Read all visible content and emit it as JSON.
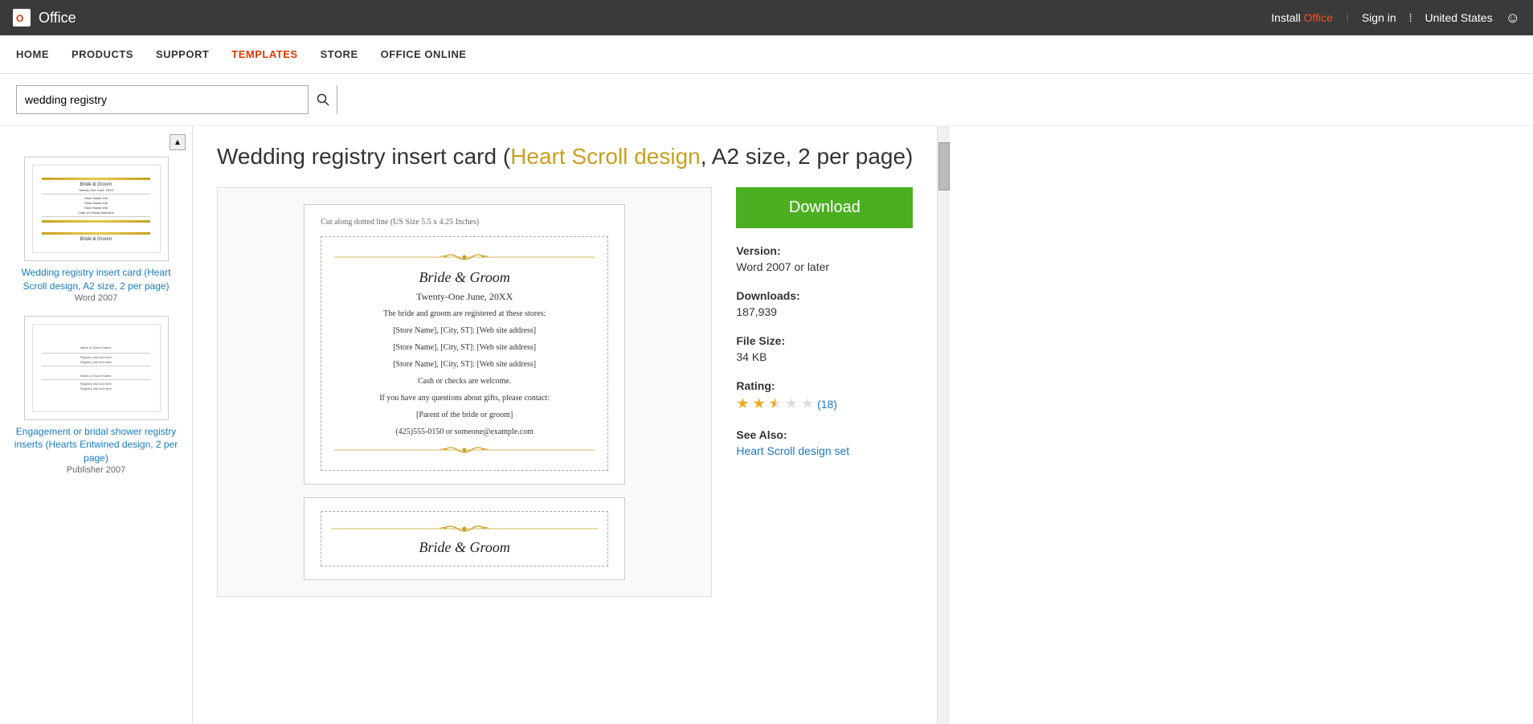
{
  "topbar": {
    "logo_text": "▣",
    "office_label": "Office",
    "install_label_1": "Install",
    "install_label_2": "Office",
    "sign_in_label": "Sign in",
    "divider": "⁞",
    "region_label": "United States",
    "emoji": "☺"
  },
  "navbar": {
    "items": [
      {
        "id": "home",
        "label": "HOME",
        "active": false
      },
      {
        "id": "products",
        "label": "PRODUCTS",
        "active": false
      },
      {
        "id": "support",
        "label": "SUPPORT",
        "active": false
      },
      {
        "id": "templates",
        "label": "TEMPLATES",
        "active": true
      },
      {
        "id": "store",
        "label": "STORE",
        "active": false
      },
      {
        "id": "office-online",
        "label": "OFFICE ONLINE",
        "active": false
      }
    ]
  },
  "search": {
    "value": "wedding registry",
    "placeholder": "Search"
  },
  "sidebar": {
    "items": [
      {
        "id": "item1",
        "label": "Wedding registry insert card (Heart Scroll design, A2 size, 2 per page)",
        "sublabel": "Word 2007",
        "active": true
      },
      {
        "id": "item2",
        "label": "Engagement or bridal shower registry inserts (Hearts Entwined design, 2 per page)",
        "sublabel": "Publisher 2007",
        "active": false
      }
    ]
  },
  "page": {
    "title_part1": "Wedding registry insert card (",
    "title_highlight": "Heart Scroll design",
    "title_part2": ", A2 size, 2 per page)"
  },
  "preview": {
    "cut_text": "Cut along dotted line (US Size 5.5 x 4.25 Inches)",
    "card1": {
      "title": "Bride & Groom",
      "date": "Twenty-One June, 20XX",
      "line1": "The bride and groom are registered at these stores:",
      "line2": "[Store Name], [City, ST]: [Web site address]",
      "line3": "[Store Name], [City, ST]: [Web site address]",
      "line4": "[Store Name], [City, ST]: [Web site address]",
      "line5": "Cash or checks are welcome.",
      "line6": "If you have any questions about gifts, please contact:",
      "line7": "[Parent of the bride or groom]",
      "line8": "(425)555-0150 or someone@example.com"
    },
    "card2": {
      "title": "Bride & Groom"
    }
  },
  "right_panel": {
    "download_label": "Download",
    "version_label": "Version:",
    "version_value": "Word 2007 or later",
    "downloads_label": "Downloads:",
    "downloads_value": "187,939",
    "file_size_label": "File Size:",
    "file_size_value": "34 KB",
    "rating_label": "Rating:",
    "rating_value": 2.5,
    "rating_count": "(18)",
    "see_also_label": "See Also:",
    "see_also_link": "Heart Scroll design set"
  }
}
